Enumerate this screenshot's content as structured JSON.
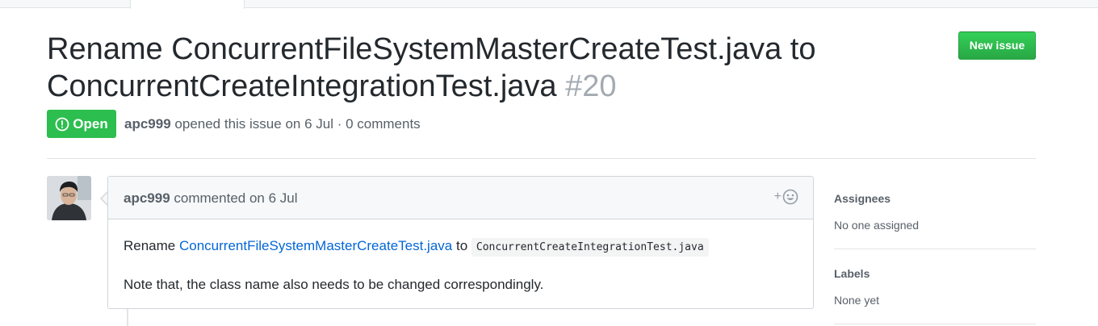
{
  "issue": {
    "title": "Rename ConcurrentFileSystemMasterCreateTest.java to ConcurrentCreateIntegrationTest.java",
    "number": "#20",
    "state": "Open",
    "author": "apc999",
    "opened_text": "opened this issue on 6 Jul · 0 comments"
  },
  "header": {
    "new_issue_label": "New issue"
  },
  "comment": {
    "author": "apc999",
    "commented_text": "commented on 6 Jul",
    "body_prefix": "Rename",
    "body_link": "ConcurrentFileSystemMasterCreateTest.java",
    "body_to": "to",
    "body_code": "ConcurrentCreateIntegrationTest.java",
    "body_note": "Note that, the class name also needs to be changed correspondingly.",
    "reaction_plus": "+"
  },
  "sidebar": {
    "assignees_title": "Assignees",
    "assignees_value": "No one assigned",
    "labels_title": "Labels",
    "labels_value": "None yet"
  },
  "colors": {
    "open_green": "#2cbe4e",
    "link_blue": "#0366d6",
    "number_gray": "#a3aab1"
  },
  "icons": {
    "state": "issue-opened-icon",
    "reaction": "smiley-icon"
  }
}
